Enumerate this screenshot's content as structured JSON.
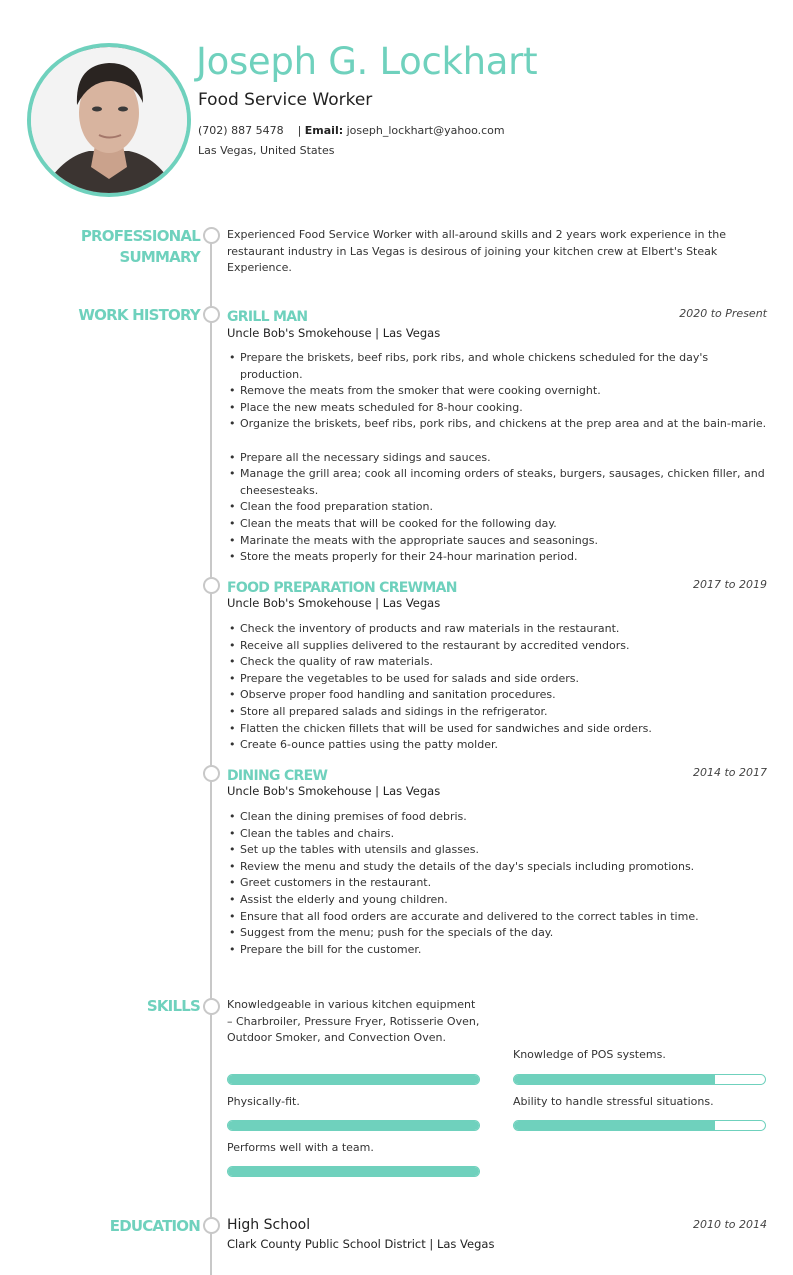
{
  "header": {
    "name": "Joseph G. Lockhart",
    "title": "Food Service Worker",
    "phone": "(702) 887 5478",
    "separator": "|",
    "email_label": "Email:",
    "email": "joseph_lockhart@yahoo.com",
    "location": "Las Vegas, United States"
  },
  "theme": {
    "accent": "#6fd1bd",
    "timeline": "#c8c8c8"
  },
  "sections": {
    "summary_label_1": "PROFESSIONAL",
    "summary_label_2": "SUMMARY",
    "work_label": "WORK HISTORY",
    "skills_label": "SKILLS",
    "education_label": "EDUCATION"
  },
  "summary": "Experienced Food Service Worker with all-around skills and 2 years work experience in the restaurant industry in Las Vegas is desirous of joining your kitchen crew at Elbert's Steak Experience.",
  "jobs": [
    {
      "title": "GRILL MAN",
      "dates": "2020 to Present",
      "employer": "Uncle Bob's Smokehouse  |  Las Vegas",
      "bullets": [
        "Prepare the briskets, beef ribs, pork ribs, and whole chickens scheduled for the day's production.",
        "Remove the meats from the smoker that were cooking overnight.",
        "Place the new meats scheduled for 8-hour cooking.",
        "Organize the briskets, beef ribs, pork ribs, and chickens at the prep area and at the bain-marie.",
        "",
        "Prepare all the necessary sidings and sauces.",
        "Manage the grill area; cook all incoming orders of steaks, burgers, sausages, chicken filler, and cheesesteaks.",
        "Clean the food preparation station.",
        "Clean the meats that will be cooked for the following day.",
        "Marinate the meats with the appropriate sauces and seasonings.",
        "Store the meats properly for their 24-hour marination period."
      ]
    },
    {
      "title": "FOOD PREPARATION CREWMAN",
      "dates": "2017 to 2019",
      "employer": "Uncle Bob's Smokehouse  |  Las Vegas",
      "bullets": [
        "Check the inventory of products and raw materials in the restaurant.",
        "Receive all supplies delivered to the restaurant by accredited vendors.",
        "Check the quality of raw materials.",
        "Prepare the vegetables to be used for salads and side orders.",
        "Observe proper food handling and sanitation procedures.",
        "Store all prepared salads and sidings in the refrigerator.",
        "Flatten the chicken fillets that will be used for sandwiches and side orders.",
        "Create 6-ounce patties using the patty molder."
      ]
    },
    {
      "title": "DINING CREW",
      "dates": "2014 to 2017",
      "employer": "Uncle Bob's Smokehouse  |  Las Vegas",
      "bullets": [
        "Clean the dining premises of food debris.",
        "Clean the tables and chairs.",
        "Set up the tables with utensils and glasses.",
        "Review the menu and study the details of the day's specials including promotions.",
        "Greet customers in the restaurant.",
        "Assist the elderly and young children.",
        "Ensure that all food orders are accurate and delivered to the correct tables in time.",
        "Suggest from the menu; push for the specials of the day.",
        "Prepare the bill for the customer."
      ]
    }
  ],
  "skills": [
    {
      "label": "Knowledgeable in various kitchen equipment – Charbroiler, Pressure Fryer, Rotisserie Oven, Outdoor Smoker, and Convection Oven.",
      "level": 1.0
    },
    {
      "label": "Knowledge of POS systems.",
      "level": 0.8
    },
    {
      "label": "Physically-fit.",
      "level": 1.0
    },
    {
      "label": "Ability to handle stressful situations.",
      "level": 0.8
    },
    {
      "label": "Performs well with a team.",
      "level": 1.0
    }
  ],
  "education": {
    "degree": "High School",
    "school": "Clark County Public School District  |  Las Vegas",
    "dates": "2010 to 2014"
  }
}
